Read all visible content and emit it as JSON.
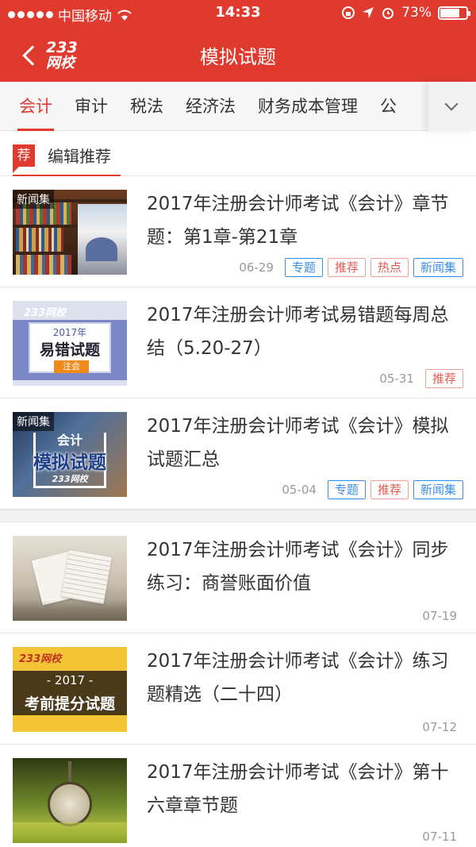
{
  "status_bar": {
    "carrier": "中国移动",
    "time": "14:33",
    "battery": "73%"
  },
  "header": {
    "logo_num": "233",
    "logo_text": "网校",
    "title": "模拟试题"
  },
  "tabs": [
    "会计",
    "审计",
    "税法",
    "经济法",
    "财务成本管理",
    "公"
  ],
  "section": {
    "badge": "荐",
    "title": "编辑推荐"
  },
  "items": [
    {
      "title": "2017年注册会计师考试《会计》章节题：第1章-第21章",
      "date": "06-29",
      "thumb_label": "新闻集",
      "tags": [
        "专题",
        "推荐",
        "热点",
        "新闻集"
      ]
    },
    {
      "title": "2017年注册会计师考试易错题每周总结（5.20-27）",
      "date": "05-31",
      "thumb_brand": "233网校",
      "thumb_year": "2017年",
      "thumb_main": "易错试题",
      "thumb_sub": "注会",
      "tags": [
        "推荐"
      ]
    },
    {
      "title": "2017年注册会计师考试《会计》模拟试题汇总",
      "date": "05-04",
      "thumb_label": "新闻集",
      "thumb_top": "会计",
      "thumb_main": "模拟试题",
      "thumb_brand": "233网校",
      "tags": [
        "专题",
        "推荐",
        "新闻集"
      ]
    },
    {
      "title": "2017年注册会计师考试《会计》同步练习：商誉账面价值",
      "date": "07-19",
      "tags": []
    },
    {
      "title": "2017年注册会计师考试《会计》练习题精选（二十四）",
      "date": "07-12",
      "thumb_brand": "233网校",
      "thumb_year": "- 2017 -",
      "thumb_main": "考前提分试题",
      "tags": []
    },
    {
      "title": "2017年注册会计师考试《会计》第十六章章节题",
      "date": "07-11",
      "tags": []
    }
  ],
  "colors": {
    "brand_red": "#e03a2f",
    "tag_blue": "#3a8ee6",
    "tag_red": "#e25b50"
  }
}
